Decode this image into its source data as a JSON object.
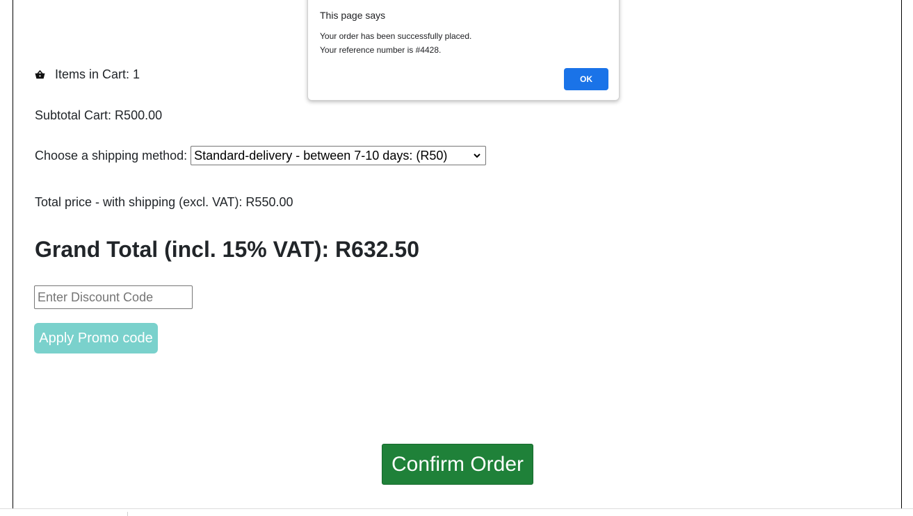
{
  "cart": {
    "icon": "basket-icon",
    "items_label": "Items in Cart: 1",
    "subtotal": "Subtotal Cart: R500.00"
  },
  "shipping": {
    "label": "Choose a shipping method:",
    "selected": "Standard-delivery - between 7-10 days: (R50)"
  },
  "totals": {
    "excl_vat": "Total price - with shipping (excl. VAT): R550.00",
    "grand_total": "Grand Total (incl. 15% VAT): R632.50"
  },
  "discount": {
    "placeholder": "Enter Discount Code",
    "button_label": "Apply Promo code",
    "button_color": "#7ad1cc"
  },
  "confirm": {
    "label": "Confirm Order",
    "color": "#1f8139"
  },
  "dialog": {
    "title": "This page says",
    "line1": "Your order has been successfully placed.",
    "line2": "Your reference number is #4428.",
    "ok_label": "OK",
    "ok_color": "#1a73e8"
  }
}
